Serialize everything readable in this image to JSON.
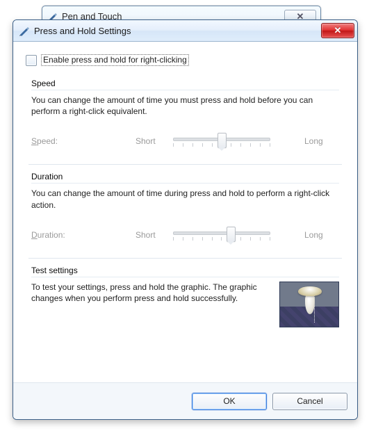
{
  "parent_window": {
    "title": "Pen and Touch",
    "close_glyph": "✕"
  },
  "dialog": {
    "title": "Press and Hold Settings",
    "close_glyph": "✕",
    "enable_checkbox": {
      "label": "Enable press and hold for right-clicking",
      "checked": false
    },
    "speed": {
      "title": "Speed",
      "description": "You can change the amount of time you must press and hold before you can perform a right-click equivalent.",
      "label": "Speed:",
      "min_label": "Short",
      "max_label": "Long",
      "value": 5,
      "ticks": 11,
      "enabled": false
    },
    "duration": {
      "title": "Duration",
      "description": "You can change the amount of time during press and hold to perform a right-click action.",
      "label": "Duration:",
      "min_label": "Short",
      "max_label": "Long",
      "value": 6,
      "ticks": 11,
      "enabled": false
    },
    "test": {
      "title": "Test settings",
      "description": "To test your settings, press and hold the graphic. The graphic changes when you perform press and hold successfully."
    },
    "buttons": {
      "ok": "OK",
      "cancel": "Cancel"
    }
  }
}
